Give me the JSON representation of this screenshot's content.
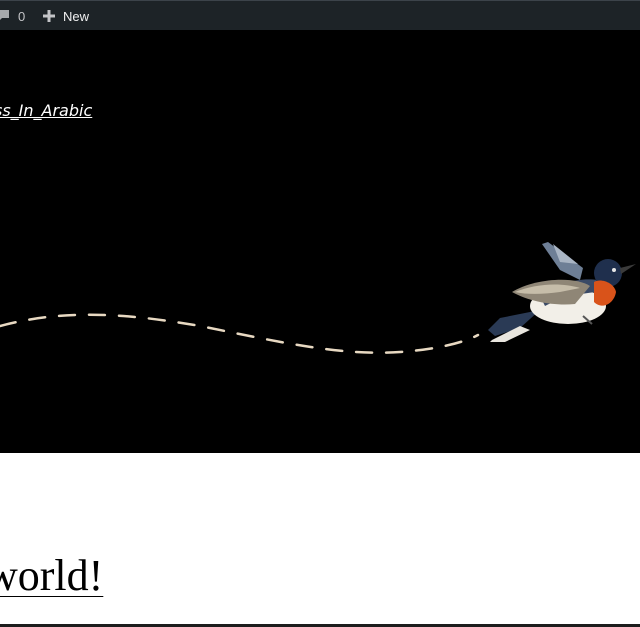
{
  "admin_bar": {
    "comments_count": "0",
    "comments_icon": "comment-bubble-icon",
    "new_label": "New",
    "new_icon": "plus-icon",
    "background": "#1d2327"
  },
  "header": {
    "site_title": "ss_In_Arabic",
    "background": "#000000",
    "illustration": "bird-flight-path-illustration"
  },
  "post": {
    "title": "world!"
  }
}
